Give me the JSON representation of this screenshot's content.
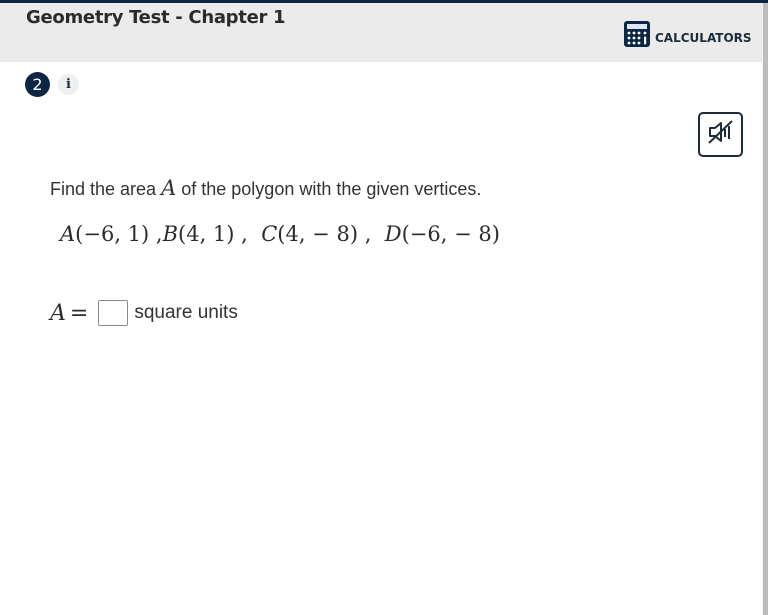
{
  "header": {
    "title": "Geometry Test - Chapter 1",
    "calculators_label": "CALCULATORS",
    "calculators_icon": "calculator-icon"
  },
  "question": {
    "number": "2",
    "info_label": "i",
    "audio_icon": "speaker-muted-icon",
    "prompt_before": "Find the area ",
    "prompt_var": "A",
    "prompt_after": " of the polygon with the given vertices.",
    "vertices": [
      {
        "label": "A",
        "coords": "(−6, 1)",
        "sep": " ,"
      },
      {
        "label": "B",
        "coords": "(4, 1)",
        "sep": " ,  "
      },
      {
        "label": "C",
        "coords": "(4, − 8)",
        "sep": " ,  "
      },
      {
        "label": "D",
        "coords": "(−6, − 8)",
        "sep": ""
      }
    ],
    "answer": {
      "variable": "A",
      "equals": "=",
      "value": "",
      "units": "square units"
    }
  },
  "colors": {
    "brand_dark": "#0d2646",
    "header_bg": "#ebebeb"
  }
}
